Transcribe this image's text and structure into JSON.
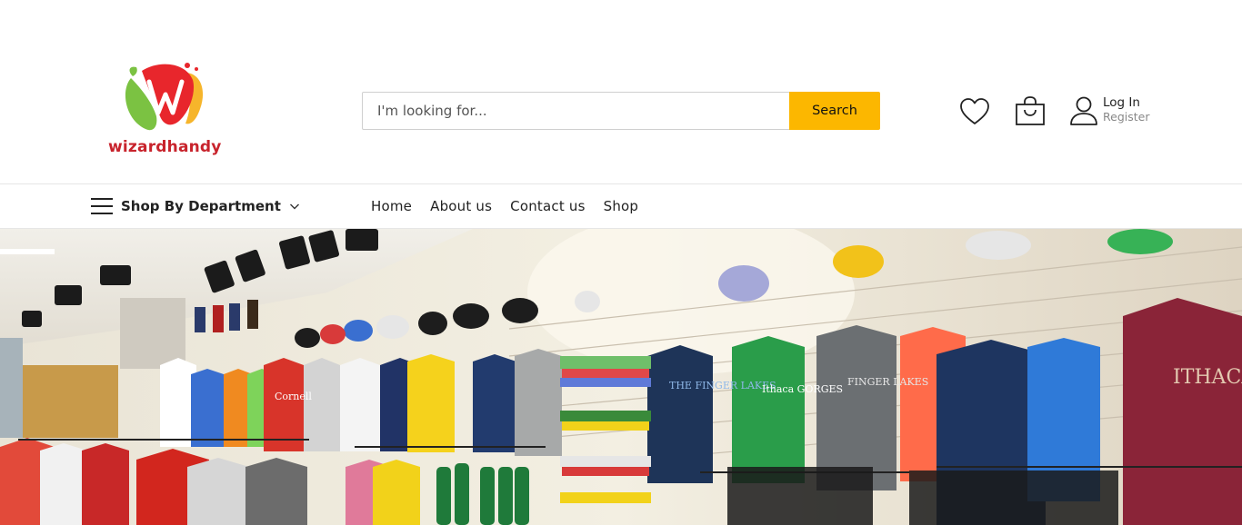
{
  "brand": {
    "name": "wizardhandy",
    "colors": {
      "red": "#e8262c",
      "green": "#7bc242",
      "yellow": "#f6b52b",
      "text": "#c8232c"
    }
  },
  "search": {
    "placeholder": "I'm looking for...",
    "value": "",
    "button_label": "Search",
    "button_color": "#fcb700"
  },
  "header_icons": {
    "wishlist": "heart-icon",
    "cart": "shopping-bag-icon",
    "account": "user-icon"
  },
  "account": {
    "login_label": "Log In",
    "register_label": "Register"
  },
  "navbar": {
    "department_label": "Shop By Department",
    "links": [
      {
        "label": "Home"
      },
      {
        "label": "About us"
      },
      {
        "label": "Contact us"
      },
      {
        "label": "Shop"
      }
    ]
  },
  "hero": {
    "image": "store interior with t-shirts, caps and water bottles on display",
    "shirt_prints": [
      "THE FINGER LAKES",
      "FINGER LAKES",
      "Ithaca GORGES",
      "ITHACA",
      "Cornell"
    ]
  }
}
